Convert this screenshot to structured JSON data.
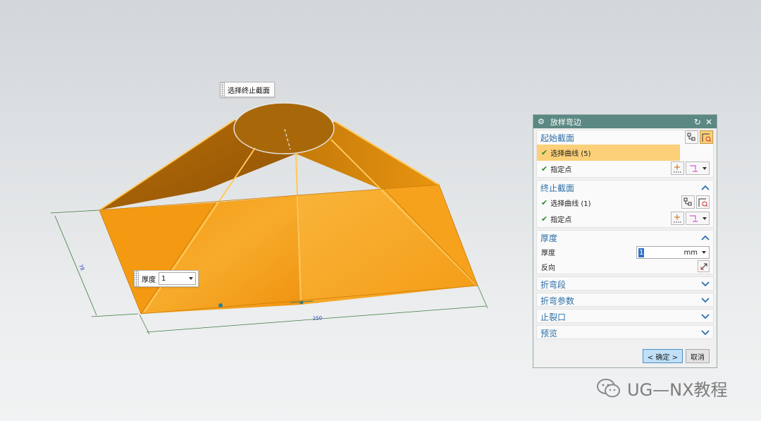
{
  "callouts": {
    "end_section": "选择终止截面",
    "thickness_label": "厚度",
    "thickness_value": "1"
  },
  "dimensions": {
    "left_text": "78",
    "bottom_text": "250"
  },
  "dialog": {
    "title": "放样弯边",
    "start_section": {
      "header": "起始截面",
      "select_curve": "选择曲线 (5)",
      "specify_point": "指定点"
    },
    "end_section": {
      "header": "终止截面",
      "select_curve": "选择曲线 (1)",
      "specify_point": "指定点"
    },
    "thickness": {
      "header": "厚度",
      "label": "厚度",
      "value": "1",
      "unit": "mm",
      "reverse_label": "反向"
    },
    "collapsed_groups": [
      "折弯段",
      "折弯参数",
      "止裂口",
      "预览"
    ],
    "ok_label": "< 确定 >",
    "cancel_label": "取消"
  },
  "watermark": "UG—NX教程",
  "colors": {
    "model_orange": "#f59b12",
    "title_bar": "#5b8882",
    "group_header": "#2d6fa8",
    "selection": "#fbd078"
  }
}
